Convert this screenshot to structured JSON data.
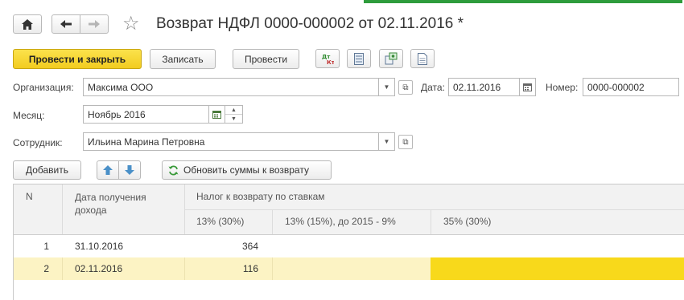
{
  "window": {
    "title": "Возврат НДФЛ 0000-000002 от 02.11.2016 *",
    "home_icon": "home-icon",
    "back_icon": "arrow-left-icon",
    "forward_icon": "arrow-right-icon",
    "star_icon": "star-icon",
    "accent_color": "#2e9c3c"
  },
  "toolbar": {
    "post_close_label": "Провести и закрыть",
    "save_label": "Записать",
    "post_label": "Провести",
    "icons": [
      "dt-kt-icon",
      "register-icon",
      "structure-icon",
      "print-icon"
    ]
  },
  "form": {
    "org_label": "Организация:",
    "org_value": "Максима ООО",
    "date_label": "Дата:",
    "date_value": "02.11.2016",
    "number_label": "Номер:",
    "number_value": "0000-000002",
    "month_label": "Месяц:",
    "month_value": "Ноябрь 2016",
    "employee_label": "Сотрудник:",
    "employee_value": "Ильина Марина Петровна"
  },
  "table_toolbar": {
    "add_label": "Добавить",
    "up_icon": "arrow-up-icon",
    "down_icon": "arrow-down-icon",
    "refresh_label": "Обновить суммы к возврату"
  },
  "table": {
    "col_n": "N",
    "col_date": "Дата получения дохода",
    "col_group": "Налог к возврату по ставкам",
    "sub_cols": [
      "13% (30%)",
      "13% (15%), до 2015 - 9%",
      "35% (30%)"
    ],
    "rows": [
      {
        "n": "1",
        "date": "31.10.2016",
        "v13": "364"
      },
      {
        "n": "2",
        "date": "02.11.2016",
        "v13": "116"
      }
    ],
    "selected_row_color": "#fcf3c4",
    "active_cell_color": "#f8d91b"
  }
}
